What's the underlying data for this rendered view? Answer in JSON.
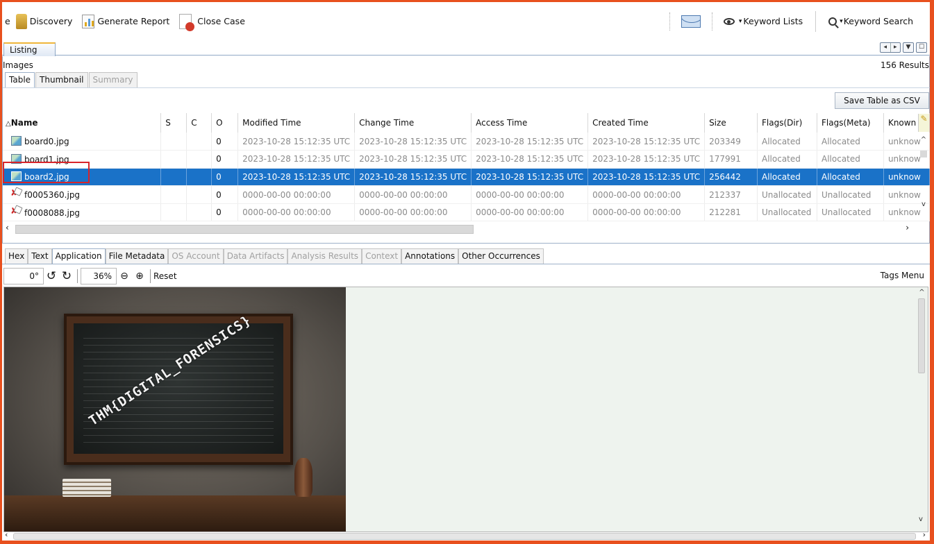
{
  "toolbar": {
    "partial_label": "e",
    "discovery_label": "Discovery",
    "generate_report_label": "Generate Report",
    "close_case_label": "Close Case",
    "keyword_lists_label": "Keyword Lists",
    "keyword_search_label": "Keyword Search"
  },
  "listing": {
    "tab_label": "Listing",
    "section_label": "Images",
    "results_count": "156  Results",
    "view_tabs": [
      "Table",
      "Thumbnail",
      "Summary"
    ],
    "save_csv_label": "Save Table as CSV",
    "columns": [
      "Name",
      "S",
      "C",
      "O",
      "Modified Time",
      "Change Time",
      "Access Time",
      "Created Time",
      "Size",
      "Flags(Dir)",
      "Flags(Meta)",
      "Known"
    ],
    "rows": [
      {
        "name": "board0.jpg",
        "s": "",
        "c": "",
        "o": "0",
        "modified": "2023-10-28 15:12:35 UTC",
        "change": "2023-10-28 15:12:35 UTC",
        "access": "2023-10-28 15:12:35 UTC",
        "created": "2023-10-28 15:12:35 UTC",
        "size": "203349",
        "flags_dir": "Allocated",
        "flags_meta": "Allocated",
        "known": "unknow",
        "deleted": false,
        "selected": false
      },
      {
        "name": "board1.jpg",
        "s": "",
        "c": "",
        "o": "0",
        "modified": "2023-10-28 15:12:35 UTC",
        "change": "2023-10-28 15:12:35 UTC",
        "access": "2023-10-28 15:12:35 UTC",
        "created": "2023-10-28 15:12:35 UTC",
        "size": "177991",
        "flags_dir": "Allocated",
        "flags_meta": "Allocated",
        "known": "unknow",
        "deleted": false,
        "selected": false
      },
      {
        "name": "board2.jpg",
        "s": "",
        "c": "",
        "o": "0",
        "modified": "2023-10-28 15:12:35 UTC",
        "change": "2023-10-28 15:12:35 UTC",
        "access": "2023-10-28 15:12:35 UTC",
        "created": "2023-10-28 15:12:35 UTC",
        "size": "256442",
        "flags_dir": "Allocated",
        "flags_meta": "Allocated",
        "known": "unknow",
        "deleted": false,
        "selected": true
      },
      {
        "name": "f0005360.jpg",
        "s": "",
        "c": "",
        "o": "0",
        "modified": "0000-00-00 00:00:00",
        "change": "0000-00-00 00:00:00",
        "access": "0000-00-00 00:00:00",
        "created": "0000-00-00 00:00:00",
        "size": "212337",
        "flags_dir": "Unallocated",
        "flags_meta": "Unallocated",
        "known": "unknow",
        "deleted": true,
        "selected": false
      },
      {
        "name": "f0008088.jpg",
        "s": "",
        "c": "",
        "o": "0",
        "modified": "0000-00-00 00:00:00",
        "change": "0000-00-00 00:00:00",
        "access": "0000-00-00 00:00:00",
        "created": "0000-00-00 00:00:00",
        "size": "212281",
        "flags_dir": "Unallocated",
        "flags_meta": "Unallocated",
        "known": "unknow",
        "deleted": true,
        "selected": false
      }
    ]
  },
  "content_viewer": {
    "tabs": [
      {
        "label": "Hex",
        "state": "normal"
      },
      {
        "label": "Text",
        "state": "normal"
      },
      {
        "label": "Application",
        "state": "active"
      },
      {
        "label": "File Metadata",
        "state": "normal"
      },
      {
        "label": "OS Account",
        "state": "disabled"
      },
      {
        "label": "Data Artifacts",
        "state": "disabled"
      },
      {
        "label": "Analysis Results",
        "state": "disabled"
      },
      {
        "label": "Context",
        "state": "disabled"
      },
      {
        "label": "Annotations",
        "state": "normal"
      },
      {
        "label": "Other Occurrences",
        "state": "normal"
      }
    ],
    "rotation": "0°",
    "zoom": "36%",
    "reset_label": "Reset",
    "tags_menu_label": "Tags Menu",
    "image_text": "THM{DIGITAL_FORENSICS}"
  },
  "colors": {
    "window_border": "#e8501e",
    "selection": "#1a72c8",
    "highlight_box": "#d8242a",
    "tab_accent": "#f0b63a"
  }
}
